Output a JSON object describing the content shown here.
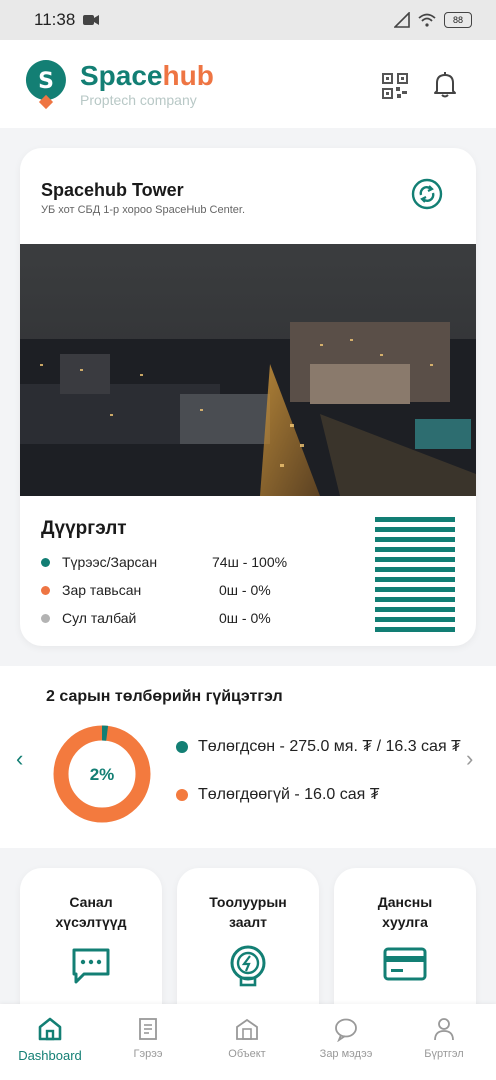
{
  "status": {
    "time": "11:38",
    "battery": "88"
  },
  "header": {
    "brand_a": "Space",
    "brand_b": "hub",
    "subtitle": "Proptech company"
  },
  "property": {
    "name": "Spacehub Tower",
    "address": "УБ хот СБД 1-р хороо SpaceHub Center."
  },
  "occupancy": {
    "title": "Дүүргэлт",
    "items": [
      {
        "label": "Түрээс/Зарсан",
        "value": "74ш - 100%",
        "color": "#127e74"
      },
      {
        "label": "Зар тавьсан",
        "value": "0ш - 0%",
        "color": "#ee7543"
      },
      {
        "label": "Сул талбай",
        "value": "0ш - 0%",
        "color": "#b3b3b3"
      }
    ],
    "fill_fraction": 1.0
  },
  "payment": {
    "title": "2 сарын төлбөрийн гүйцэтгэл",
    "percent_label": "2%",
    "percent": 2,
    "paid": "Төлөгдсөн - 275.0 мя. ₮ / 16.3 сая ₮",
    "unpaid": "Төлөгдөөгүй - 16.0 сая ₮",
    "paid_color": "#137f74",
    "unpaid_color": "#f37a3e"
  },
  "tiles": [
    {
      "label": "Санал хүсэлтүүд",
      "icon": "message-icon"
    },
    {
      "label": "Тоолуурын заалт",
      "icon": "meter-icon"
    },
    {
      "label": "Дансны хуулга",
      "icon": "card-icon"
    }
  ],
  "nav": [
    {
      "label": "Dashboard",
      "icon": "home-icon",
      "active": true
    },
    {
      "label": "Гэрээ",
      "icon": "contract-icon"
    },
    {
      "label": "Объект",
      "icon": "building-icon"
    },
    {
      "label": "Зар мэдээ",
      "icon": "chat-icon"
    },
    {
      "label": "Бүртгэл",
      "icon": "user-icon"
    }
  ],
  "colors": {
    "primary": "#137f74",
    "accent": "#ee7543"
  }
}
